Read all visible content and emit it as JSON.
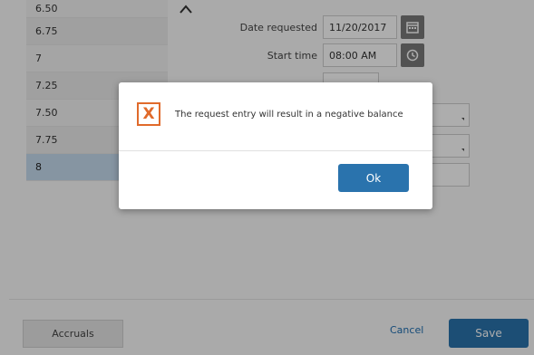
{
  "hours": {
    "items": [
      "6.50",
      "6.75",
      "7",
      "7.25",
      "7.50",
      "7.75",
      "8"
    ],
    "selected_index": 6
  },
  "form": {
    "date_requested": {
      "label": "Date requested",
      "value": "11/20/2017",
      "icon": "calendar-icon"
    },
    "start_time": {
      "label": "Start time",
      "value": "08:00 AM",
      "icon": "clock-icon"
    }
  },
  "footer": {
    "accruals_label": "Accruals",
    "cancel_label": "Cancel",
    "save_label": "Save"
  },
  "dialog": {
    "icon": "error-x-icon",
    "icon_glyph": "X",
    "message": "The request entry will result in a negative balance",
    "ok_label": "Ok"
  },
  "colors": {
    "accent": "#2a73ad",
    "error": "#e06a2b",
    "selected_row": "#c6dcef"
  }
}
